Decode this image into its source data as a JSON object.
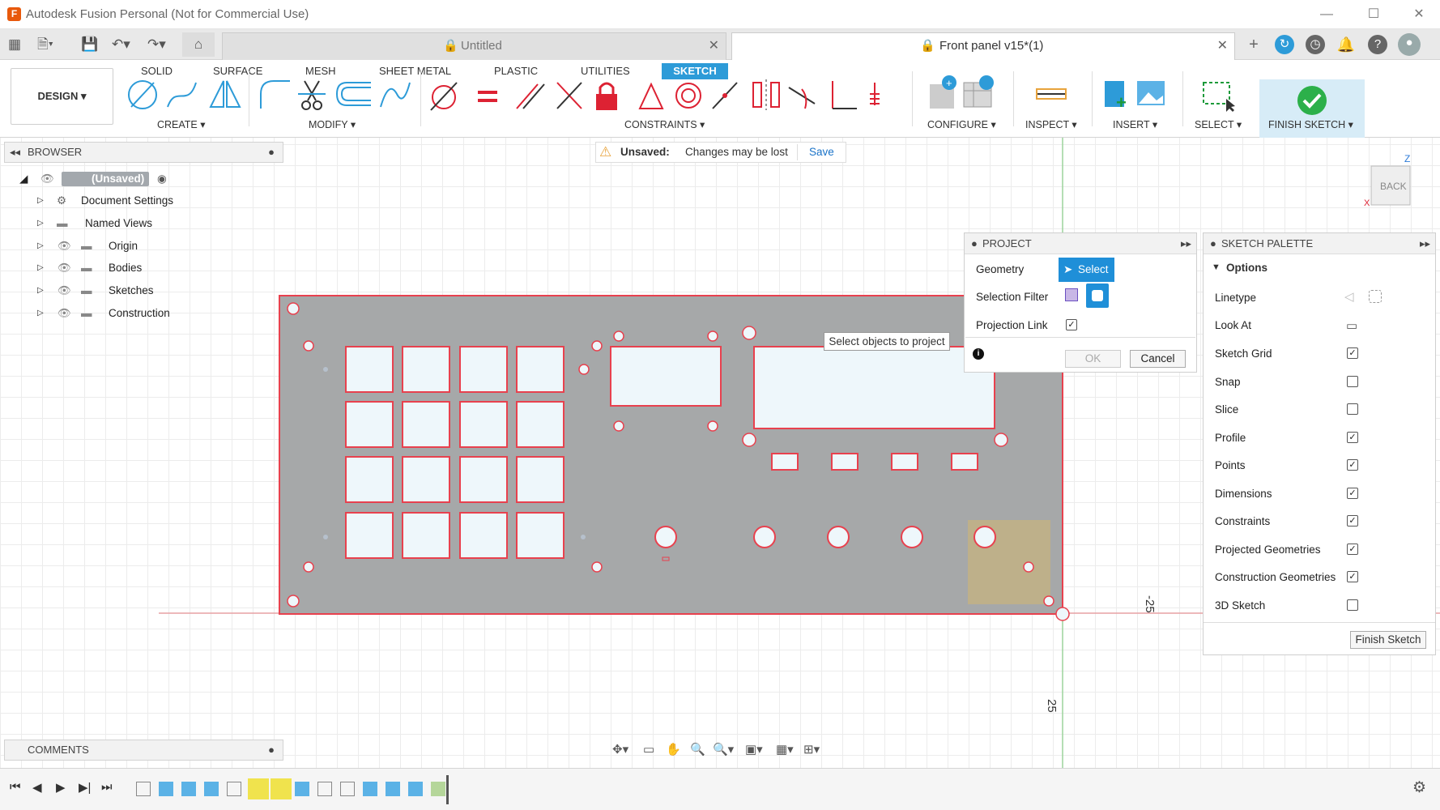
{
  "window": {
    "title": "Autodesk Fusion Personal (Not for Commercial Use)",
    "logo": "F",
    "minimize": "—",
    "maximize": "☐",
    "close": "✕"
  },
  "tabs": [
    {
      "label": "Untitled",
      "close": "✕"
    },
    {
      "label": "Front panel v15*(1)",
      "close": "✕"
    }
  ],
  "ribbon": {
    "tabs": [
      "SOLID",
      "SURFACE",
      "MESH",
      "SHEET METAL",
      "PLASTIC",
      "UTILITIES",
      "SKETCH"
    ],
    "active_tab": "SKETCH",
    "workspace": "DESIGN ▾",
    "groups": {
      "create": "CREATE ▾",
      "modify": "MODIFY ▾",
      "constraints": "CONSTRAINTS ▾",
      "configure": "CONFIGURE ▾",
      "inspect": "INSPECT ▾",
      "insert": "INSERT ▾",
      "select": "SELECT ▾",
      "finish": "FINISH SKETCH ▾"
    }
  },
  "browser": {
    "title": "BROWSER",
    "root": "(Unsaved)",
    "items": [
      "Document Settings",
      "Named Views",
      "Origin",
      "Bodies",
      "Sketches",
      "Construction"
    ]
  },
  "unsaved": {
    "label": "Unsaved:",
    "message": "Changes may be lost",
    "save": "Save"
  },
  "project": {
    "title": "PROJECT",
    "geometry_label": "Geometry",
    "select_button": "Select",
    "selection_filter_label": "Selection Filter",
    "projection_link_label": "Projection Link",
    "projection_link": true,
    "tooltip": "Select objects to project",
    "ok": "OK",
    "cancel": "Cancel"
  },
  "palette": {
    "title": "SKETCH PALETTE",
    "section": "Options",
    "rows": [
      {
        "label": "Linetype",
        "type": "icons"
      },
      {
        "label": "Look At",
        "type": "icon"
      },
      {
        "label": "Sketch Grid",
        "checked": true
      },
      {
        "label": "Snap",
        "checked": false
      },
      {
        "label": "Slice",
        "checked": false
      },
      {
        "label": "Profile",
        "checked": true
      },
      {
        "label": "Points",
        "checked": true
      },
      {
        "label": "Dimensions",
        "checked": true
      },
      {
        "label": "Constraints",
        "checked": true
      },
      {
        "label": "Projected Geometries",
        "checked": true
      },
      {
        "label": "Construction Geometries",
        "checked": true
      },
      {
        "label": "3D Sketch",
        "checked": false
      }
    ],
    "finish_button": "Finish Sketch"
  },
  "viewcube": {
    "face": "BACK",
    "axis_z": "Z",
    "axis_x": "X"
  },
  "dimensions": {
    "d1": "-25",
    "d2": "25"
  },
  "comments": {
    "title": "COMMENTS"
  },
  "colors": {
    "accent": "#2d9bd8",
    "sketch_line": "#e8414e",
    "body_fill": "#a6a8a9",
    "slot_fill": "#eef7fb",
    "highlight": "#f0e34d"
  }
}
